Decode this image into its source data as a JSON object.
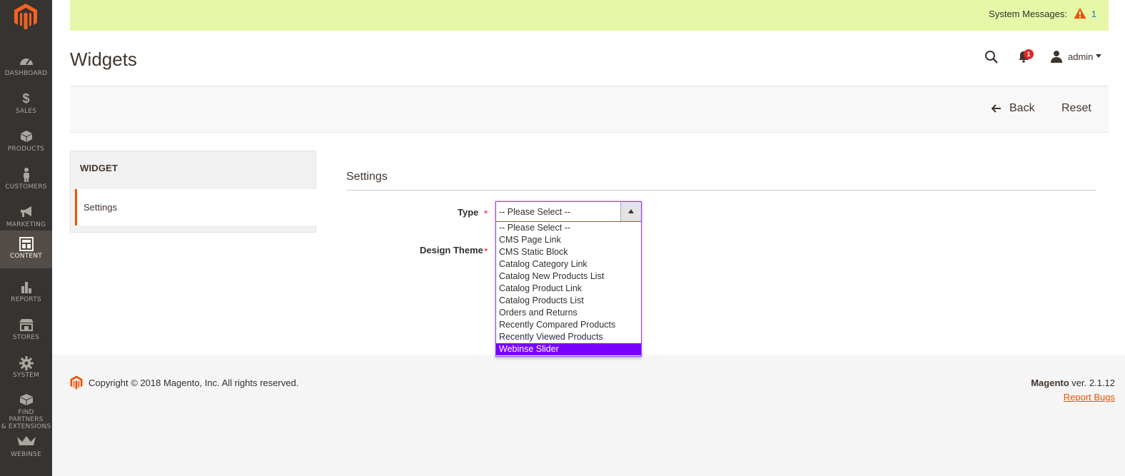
{
  "sidebar": {
    "items": [
      {
        "label": "DASHBOARD"
      },
      {
        "label": "SALES"
      },
      {
        "label": "PRODUCTS"
      },
      {
        "label": "CUSTOMERS"
      },
      {
        "label": "MARKETING"
      },
      {
        "label": "CONTENT"
      },
      {
        "label": "REPORTS"
      },
      {
        "label": "STORES"
      },
      {
        "label": "SYSTEM"
      },
      {
        "label_line1": "FIND PARTNERS",
        "label_line2": "& EXTENSIONS"
      },
      {
        "label": "WEBINSE"
      }
    ],
    "active": "CONTENT"
  },
  "system_messages": {
    "label": "System Messages:",
    "count": "1"
  },
  "header": {
    "title": "Widgets",
    "notifications_count": "1",
    "user": "admin"
  },
  "actions": {
    "back": "Back",
    "reset": "Reset"
  },
  "tabs": {
    "title": "WIDGET",
    "items": [
      {
        "label": "Settings"
      }
    ]
  },
  "settings": {
    "title": "Settings",
    "type_label": "Type",
    "design_theme_label": "Design Theme",
    "required_mark": "*",
    "type_select": {
      "value": "-- Please Select --",
      "options": [
        "-- Please Select --",
        "CMS Page Link",
        "CMS Static Block",
        "Catalog Category Link",
        "Catalog New Products List",
        "Catalog Product Link",
        "Catalog Products List",
        "Orders and Returns",
        "Recently Compared Products",
        "Recently Viewed Products",
        "Webinse Slider"
      ],
      "highlighted": "Webinse Slider"
    }
  },
  "footer": {
    "copyright": "Copyright © 2018 Magento, Inc. All rights reserved.",
    "brand": "Magento",
    "version": " ver. 2.1.12",
    "report_bugs": "Report Bugs"
  },
  "colors": {
    "sidebar_bg": "#373330",
    "accent": "#eb5202",
    "system_message_bg": "#e6f7a7",
    "dropdown_highlight": "#7800ff"
  }
}
